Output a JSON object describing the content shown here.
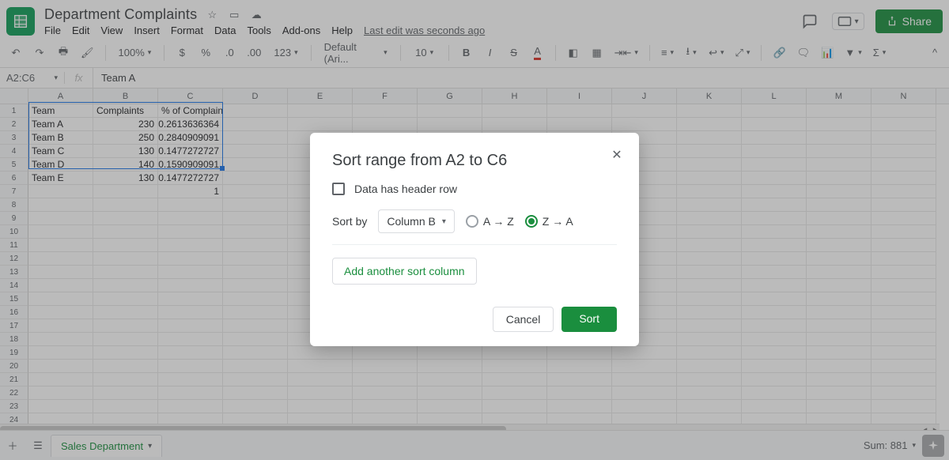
{
  "header": {
    "doc_title": "Department Complaints",
    "menus": [
      "File",
      "Edit",
      "View",
      "Insert",
      "Format",
      "Data",
      "Tools",
      "Add-ons",
      "Help"
    ],
    "last_edit": "Last edit was seconds ago",
    "share_label": "Share"
  },
  "toolbar": {
    "zoom": "100%",
    "number_format": "123",
    "font": "Default (Ari...",
    "font_size": "10"
  },
  "formula_bar": {
    "range": "A2:C6",
    "value": "Team A"
  },
  "columns": [
    "A",
    "B",
    "C",
    "D",
    "E",
    "F",
    "G",
    "H",
    "I",
    "J",
    "K",
    "L",
    "M",
    "N"
  ],
  "grid": {
    "headers": [
      "Team",
      "Complaints",
      "% of Complaints"
    ],
    "rows": [
      {
        "team": "Team A",
        "complaints": "230",
        "pct": "0.2613636364"
      },
      {
        "team": "Team B",
        "complaints": "250",
        "pct": "0.2840909091"
      },
      {
        "team": "Team C",
        "complaints": "130",
        "pct": "0.1477272727"
      },
      {
        "team": "Team D",
        "complaints": "140",
        "pct": "0.1590909091"
      },
      {
        "team": "Team E",
        "complaints": "130",
        "pct": "0.1477272727"
      }
    ],
    "sum_row_pct": "1",
    "total_rows": 25
  },
  "dialog": {
    "title": "Sort range from A2 to C6",
    "header_checkbox_label": "Data has header row",
    "sort_by_label": "Sort by",
    "sort_column": "Column B",
    "az_label": "A → Z",
    "za_label": "Z → A",
    "selected_order": "za",
    "add_column_label": "Add another sort column",
    "cancel": "Cancel",
    "sort": "Sort"
  },
  "bottom": {
    "sheet_name": "Sales Department",
    "sum_label": "Sum: 881"
  }
}
